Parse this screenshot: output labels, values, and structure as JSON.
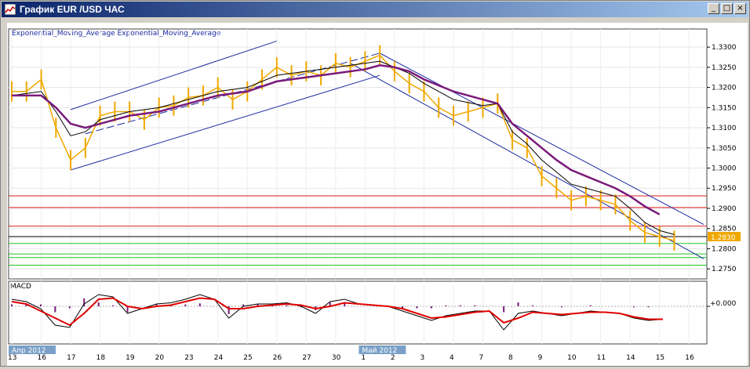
{
  "window": {
    "title": "График EUR /USD  ЧАС",
    "controls": {
      "minimize": "_",
      "maximize": "□",
      "close": "×"
    }
  },
  "chart_data": [
    {
      "type": "line",
      "panel": "price",
      "indicator_label": "Exponential_Moving_Average Exponential_Moving_Average",
      "ylim": [
        1.2725,
        1.3345
      ],
      "y_ticks": [
        "1.3300",
        "1.3250",
        "1.3200",
        "1.3150",
        "1.3100",
        "1.3050",
        "1.3000",
        "1.2950",
        "1.2900",
        "1.2850",
        "1.2800",
        "1.2750"
      ],
      "x_tick_labels": [
        "13",
        "16",
        "17",
        "18",
        "19",
        "20",
        "23",
        "24",
        "25",
        "26",
        "27",
        "30",
        "1",
        "2",
        "3",
        "4",
        "7",
        "8",
        "9",
        "10",
        "11",
        "14",
        "15",
        "16"
      ],
      "period_labels": [
        "Апр 2012",
        "Май 2012"
      ],
      "current_price": "1.2830",
      "horizontal_levels": [
        {
          "value": 1.2931,
          "color": "#e02020"
        },
        {
          "value": 1.2902,
          "color": "#e02020"
        },
        {
          "value": 1.2856,
          "color": "#e02020"
        },
        {
          "value": 1.283,
          "color": "#000000"
        },
        {
          "value": 1.2813,
          "color": "#22c822"
        },
        {
          "value": 1.2787,
          "color": "#22c822"
        },
        {
          "value": 1.2778,
          "color": "#22c822"
        },
        {
          "value": 1.2759,
          "color": "#22c822"
        }
      ],
      "series": [
        {
          "name": "",
          "role": "price",
          "color": "#f0a800",
          "points": [
            [
              0,
              1.319
            ],
            [
              1,
              1.319
            ],
            [
              2,
              1.322
            ],
            [
              3,
              1.31
            ],
            [
              4,
              1.302
            ],
            [
              5,
              1.305
            ],
            [
              6,
              1.313
            ],
            [
              7,
              1.314
            ],
            [
              8,
              1.314
            ],
            [
              9,
              1.312
            ],
            [
              10,
              1.315
            ],
            [
              11,
              1.3155
            ],
            [
              12,
              1.3175
            ],
            [
              13,
              1.318
            ],
            [
              14,
              1.32
            ],
            [
              15,
              1.317
            ],
            [
              16,
              1.319
            ],
            [
              17,
              1.322
            ],
            [
              18,
              1.325
            ],
            [
              19,
              1.323
            ],
            [
              20,
              1.324
            ],
            [
              21,
              1.323
            ],
            [
              22,
              1.326
            ],
            [
              23,
              1.325
            ],
            [
              24,
              1.3265
            ],
            [
              25,
              1.328
            ],
            [
              26,
              1.324
            ],
            [
              27,
              1.321
            ],
            [
              28,
              1.319
            ],
            [
              29,
              1.315
            ],
            [
              30,
              1.313
            ],
            [
              31,
              1.314
            ],
            [
              32,
              1.315
            ],
            [
              33,
              1.316
            ],
            [
              34,
              1.307
            ],
            [
              35,
              1.305
            ],
            [
              36,
              1.298
            ],
            [
              37,
              1.295
            ],
            [
              38,
              1.292
            ],
            [
              39,
              1.293
            ],
            [
              40,
              1.292
            ],
            [
              41,
              1.291
            ],
            [
              42,
              1.287
            ],
            [
              43,
              1.284
            ],
            [
              44,
              1.283
            ],
            [
              45,
              1.282
            ]
          ]
        },
        {
          "name": "",
          "role": "ema-fast",
          "color": "#000000",
          "points": [
            [
              0,
              1.318
            ],
            [
              2,
              1.319
            ],
            [
              3,
              1.314
            ],
            [
              4,
              1.308
            ],
            [
              5,
              1.309
            ],
            [
              6,
              1.312
            ],
            [
              8,
              1.314
            ],
            [
              10,
              1.315
            ],
            [
              12,
              1.317
            ],
            [
              14,
              1.319
            ],
            [
              16,
              1.32
            ],
            [
              18,
              1.323
            ],
            [
              20,
              1.324
            ],
            [
              22,
              1.325
            ],
            [
              24,
              1.326
            ],
            [
              25,
              1.3265
            ],
            [
              26,
              1.325
            ],
            [
              27,
              1.3235
            ],
            [
              28,
              1.321
            ],
            [
              30,
              1.317
            ],
            [
              32,
              1.3155
            ],
            [
              33,
              1.316
            ],
            [
              34,
              1.309
            ],
            [
              35,
              1.306
            ],
            [
              36,
              1.302
            ],
            [
              37,
              1.299
            ],
            [
              38,
              1.296
            ],
            [
              39,
              1.295
            ],
            [
              40,
              1.294
            ],
            [
              41,
              1.293
            ],
            [
              42,
              1.29
            ],
            [
              43,
              1.2865
            ],
            [
              44,
              1.2845
            ],
            [
              45,
              1.2835
            ]
          ]
        },
        {
          "name": "",
          "role": "ema-slow",
          "color": "#7a1a7a",
          "points": [
            [
              0,
              1.318
            ],
            [
              2,
              1.318
            ],
            [
              3,
              1.315
            ],
            [
              4,
              1.311
            ],
            [
              5,
              1.31
            ],
            [
              6,
              1.311
            ],
            [
              8,
              1.313
            ],
            [
              10,
              1.314
            ],
            [
              12,
              1.316
            ],
            [
              14,
              1.318
            ],
            [
              16,
              1.319
            ],
            [
              18,
              1.3215
            ],
            [
              20,
              1.3225
            ],
            [
              22,
              1.3235
            ],
            [
              24,
              1.3245
            ],
            [
              25,
              1.3255
            ],
            [
              26,
              1.325
            ],
            [
              27,
              1.324
            ],
            [
              28,
              1.322
            ],
            [
              30,
              1.319
            ],
            [
              32,
              1.317
            ],
            [
              33,
              1.316
            ],
            [
              34,
              1.311
            ],
            [
              35,
              1.308
            ],
            [
              36,
              1.305
            ],
            [
              37,
              1.302
            ],
            [
              38,
              1.2995
            ],
            [
              39,
              1.298
            ],
            [
              40,
              1.2965
            ],
            [
              41,
              1.295
            ],
            [
              42,
              1.293
            ],
            [
              43,
              1.2905
            ],
            [
              44,
              1.2885
            ]
          ]
        }
      ],
      "channel_lines": [
        {
          "color": "#1a2aa0",
          "dash": false,
          "from": [
            4,
            1.2995
          ],
          "to": [
            25,
            1.323
          ]
        },
        {
          "color": "#1a2aa0",
          "dash": false,
          "from": [
            4,
            1.3145
          ],
          "to": [
            18,
            1.3315
          ]
        },
        {
          "color": "#1a2aa0",
          "dash": true,
          "from": [
            5,
            1.3085
          ],
          "to": [
            25,
            1.3285
          ]
        },
        {
          "color": "#1a2aa0",
          "dash": false,
          "from": [
            25,
            1.3285
          ],
          "to": [
            47,
            1.286
          ]
        },
        {
          "color": "#1a2aa0",
          "dash": false,
          "from": [
            23,
            1.326
          ],
          "to": [
            47,
            1.2775
          ]
        }
      ]
    },
    {
      "type": "line",
      "panel": "macd",
      "title": "MACD",
      "y_ticks": [
        "+0.000"
      ],
      "ylim": [
        -1,
        1
      ],
      "series": [
        {
          "name": "",
          "role": "macd-main",
          "color": "#000000",
          "values": [
            0.3,
            0.2,
            -0.1,
            -0.8,
            -0.9,
            0.1,
            0.5,
            0.4,
            -0.3,
            -0.1,
            0.1,
            0.15,
            0.3,
            0.5,
            0.3,
            -0.5,
            0.0,
            0.1,
            0.1,
            0.15,
            0.0,
            -0.3,
            0.2,
            0.3,
            0.1,
            0.05,
            0.0,
            -0.2,
            -0.4,
            -0.6,
            -0.4,
            -0.3,
            -0.2,
            -0.2,
            -1.0,
            -0.3,
            -0.2,
            -0.3,
            -0.4,
            -0.3,
            -0.2,
            -0.25,
            -0.3,
            -0.5,
            -0.6,
            -0.55
          ]
        },
        {
          "name": "",
          "role": "macd-signal",
          "color": "#e00000",
          "values": [
            0.2,
            0.1,
            -0.2,
            -0.5,
            -0.8,
            -0.3,
            0.3,
            0.35,
            0.0,
            -0.1,
            0.0,
            0.05,
            0.2,
            0.35,
            0.3,
            -0.1,
            -0.1,
            0.0,
            0.05,
            0.1,
            0.05,
            -0.1,
            0.0,
            0.15,
            0.1,
            0.05,
            0.0,
            -0.1,
            -0.3,
            -0.5,
            -0.45,
            -0.35,
            -0.25,
            -0.2,
            -0.7,
            -0.5,
            -0.25,
            -0.3,
            -0.35,
            -0.3,
            -0.25,
            -0.25,
            -0.3,
            -0.45,
            -0.55,
            -0.55
          ]
        }
      ]
    }
  ]
}
